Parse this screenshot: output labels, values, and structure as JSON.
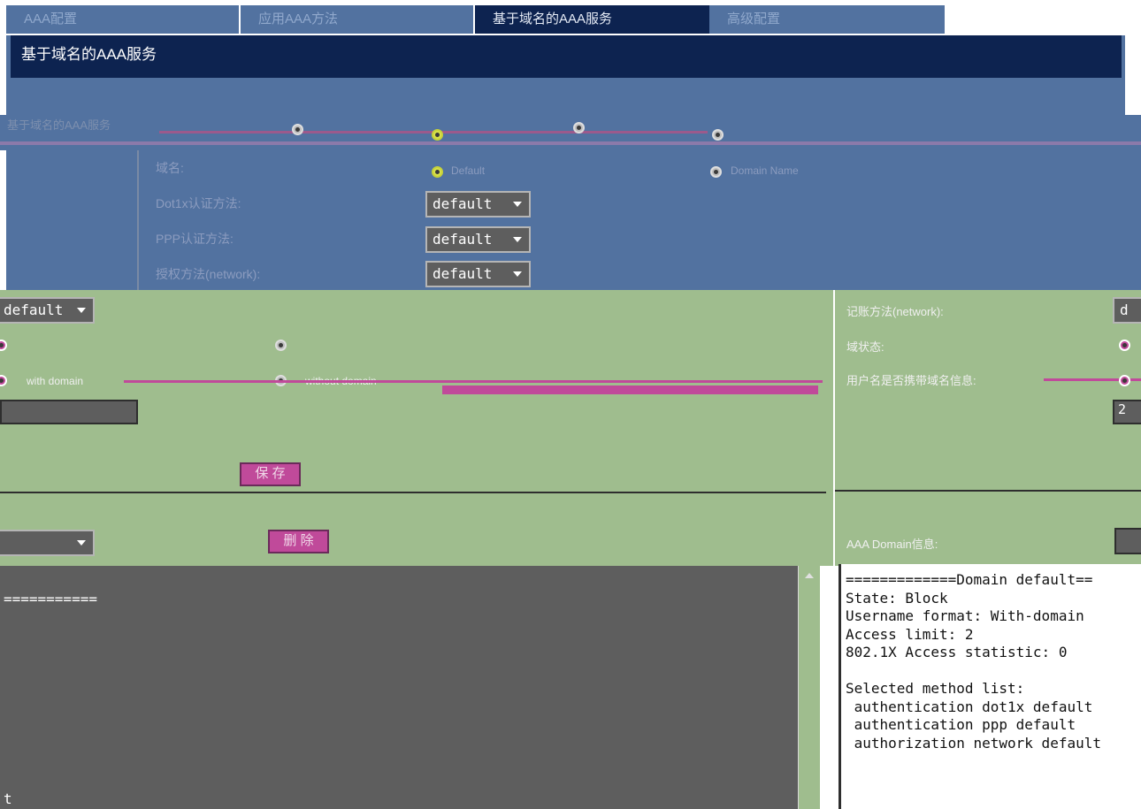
{
  "tabs": [
    {
      "label": "AAA配置"
    },
    {
      "label": "应用AAA方法"
    },
    {
      "label": "基于域名的AAA服务"
    },
    {
      "label": "高级配置"
    }
  ],
  "page_title": "基于域名的AAA服务",
  "scope_label": "基于域名的AAA服务",
  "form": {
    "domain_label": "域名:",
    "domain_option_default": "Default",
    "domain_option_name": "Domain Name",
    "dot1x_label": "Dot1x认证方法:",
    "dot1x_value": "default",
    "ppp_label": "PPP认证方法:",
    "ppp_value": "default",
    "authz_label": "授权方法(network):",
    "authz_value": "default",
    "acct_value": "default",
    "with_domain": "with domain",
    "without_domain": "without domain",
    "acct_label": "记账方法(network):",
    "acct_value_right": "d",
    "state_label": "域状态:",
    "username_label": "用户名是否携带域名信息:",
    "limit_value": "2",
    "save_button": "保 存",
    "delete_button": "删 除",
    "aaa_domain_label": "AAA Domain信息:"
  },
  "console": {
    "line1": "===========",
    "line_last": "t"
  },
  "info_text": "=============Domain default==\nState: Block\nUsername format: With-domain\nAccess limit: 2\n802.1X Access statistic: 0\n\nSelected method list:\n authentication dot1x default\n authentication ppp default\n authorization network default"
}
